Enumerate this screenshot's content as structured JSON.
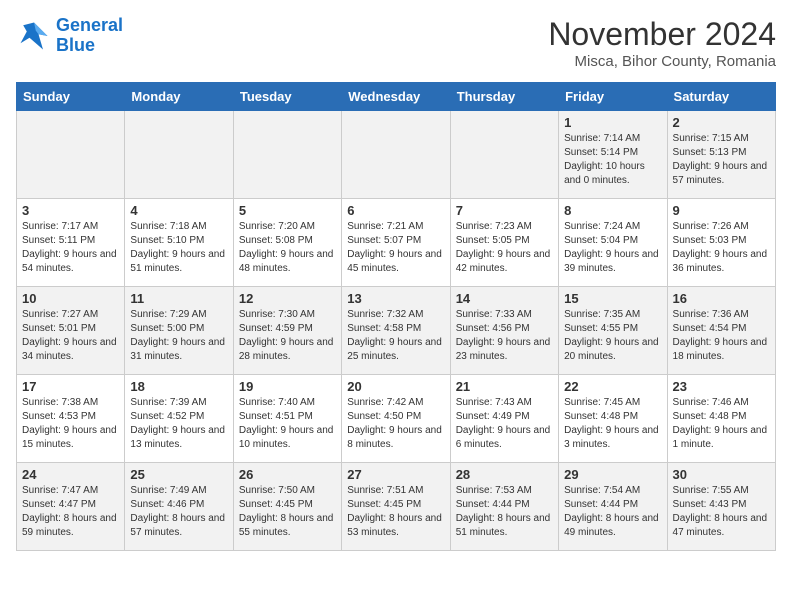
{
  "header": {
    "logo_line1": "General",
    "logo_line2": "Blue",
    "month_year": "November 2024",
    "location": "Misca, Bihor County, Romania"
  },
  "calendar": {
    "days_of_week": [
      "Sunday",
      "Monday",
      "Tuesday",
      "Wednesday",
      "Thursday",
      "Friday",
      "Saturday"
    ],
    "weeks": [
      [
        {
          "day": "",
          "info": ""
        },
        {
          "day": "",
          "info": ""
        },
        {
          "day": "",
          "info": ""
        },
        {
          "day": "",
          "info": ""
        },
        {
          "day": "",
          "info": ""
        },
        {
          "day": "1",
          "info": "Sunrise: 7:14 AM\nSunset: 5:14 PM\nDaylight: 10 hours\nand 0 minutes."
        },
        {
          "day": "2",
          "info": "Sunrise: 7:15 AM\nSunset: 5:13 PM\nDaylight: 9 hours\nand 57 minutes."
        }
      ],
      [
        {
          "day": "3",
          "info": "Sunrise: 7:17 AM\nSunset: 5:11 PM\nDaylight: 9 hours\nand 54 minutes."
        },
        {
          "day": "4",
          "info": "Sunrise: 7:18 AM\nSunset: 5:10 PM\nDaylight: 9 hours\nand 51 minutes."
        },
        {
          "day": "5",
          "info": "Sunrise: 7:20 AM\nSunset: 5:08 PM\nDaylight: 9 hours\nand 48 minutes."
        },
        {
          "day": "6",
          "info": "Sunrise: 7:21 AM\nSunset: 5:07 PM\nDaylight: 9 hours\nand 45 minutes."
        },
        {
          "day": "7",
          "info": "Sunrise: 7:23 AM\nSunset: 5:05 PM\nDaylight: 9 hours\nand 42 minutes."
        },
        {
          "day": "8",
          "info": "Sunrise: 7:24 AM\nSunset: 5:04 PM\nDaylight: 9 hours\nand 39 minutes."
        },
        {
          "day": "9",
          "info": "Sunrise: 7:26 AM\nSunset: 5:03 PM\nDaylight: 9 hours\nand 36 minutes."
        }
      ],
      [
        {
          "day": "10",
          "info": "Sunrise: 7:27 AM\nSunset: 5:01 PM\nDaylight: 9 hours\nand 34 minutes."
        },
        {
          "day": "11",
          "info": "Sunrise: 7:29 AM\nSunset: 5:00 PM\nDaylight: 9 hours\nand 31 minutes."
        },
        {
          "day": "12",
          "info": "Sunrise: 7:30 AM\nSunset: 4:59 PM\nDaylight: 9 hours\nand 28 minutes."
        },
        {
          "day": "13",
          "info": "Sunrise: 7:32 AM\nSunset: 4:58 PM\nDaylight: 9 hours\nand 25 minutes."
        },
        {
          "day": "14",
          "info": "Sunrise: 7:33 AM\nSunset: 4:56 PM\nDaylight: 9 hours\nand 23 minutes."
        },
        {
          "day": "15",
          "info": "Sunrise: 7:35 AM\nSunset: 4:55 PM\nDaylight: 9 hours\nand 20 minutes."
        },
        {
          "day": "16",
          "info": "Sunrise: 7:36 AM\nSunset: 4:54 PM\nDaylight: 9 hours\nand 18 minutes."
        }
      ],
      [
        {
          "day": "17",
          "info": "Sunrise: 7:38 AM\nSunset: 4:53 PM\nDaylight: 9 hours\nand 15 minutes."
        },
        {
          "day": "18",
          "info": "Sunrise: 7:39 AM\nSunset: 4:52 PM\nDaylight: 9 hours\nand 13 minutes."
        },
        {
          "day": "19",
          "info": "Sunrise: 7:40 AM\nSunset: 4:51 PM\nDaylight: 9 hours\nand 10 minutes."
        },
        {
          "day": "20",
          "info": "Sunrise: 7:42 AM\nSunset: 4:50 PM\nDaylight: 9 hours\nand 8 minutes."
        },
        {
          "day": "21",
          "info": "Sunrise: 7:43 AM\nSunset: 4:49 PM\nDaylight: 9 hours\nand 6 minutes."
        },
        {
          "day": "22",
          "info": "Sunrise: 7:45 AM\nSunset: 4:48 PM\nDaylight: 9 hours\nand 3 minutes."
        },
        {
          "day": "23",
          "info": "Sunrise: 7:46 AM\nSunset: 4:48 PM\nDaylight: 9 hours\nand 1 minute."
        }
      ],
      [
        {
          "day": "24",
          "info": "Sunrise: 7:47 AM\nSunset: 4:47 PM\nDaylight: 8 hours\nand 59 minutes."
        },
        {
          "day": "25",
          "info": "Sunrise: 7:49 AM\nSunset: 4:46 PM\nDaylight: 8 hours\nand 57 minutes."
        },
        {
          "day": "26",
          "info": "Sunrise: 7:50 AM\nSunset: 4:45 PM\nDaylight: 8 hours\nand 55 minutes."
        },
        {
          "day": "27",
          "info": "Sunrise: 7:51 AM\nSunset: 4:45 PM\nDaylight: 8 hours\nand 53 minutes."
        },
        {
          "day": "28",
          "info": "Sunrise: 7:53 AM\nSunset: 4:44 PM\nDaylight: 8 hours\nand 51 minutes."
        },
        {
          "day": "29",
          "info": "Sunrise: 7:54 AM\nSunset: 4:44 PM\nDaylight: 8 hours\nand 49 minutes."
        },
        {
          "day": "30",
          "info": "Sunrise: 7:55 AM\nSunset: 4:43 PM\nDaylight: 8 hours\nand 47 minutes."
        }
      ]
    ]
  }
}
